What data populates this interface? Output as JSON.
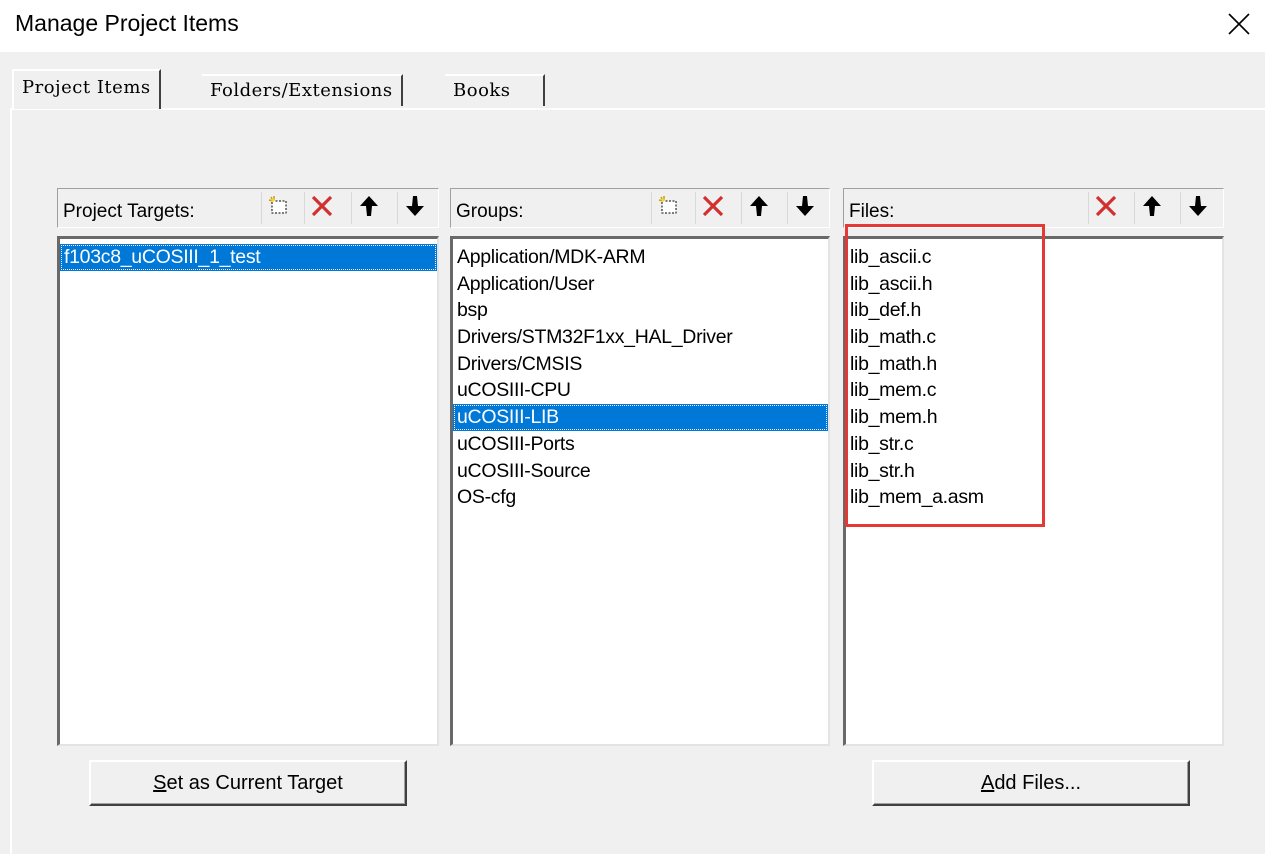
{
  "window": {
    "title": "Manage Project Items"
  },
  "tabs": [
    {
      "label": "Project Items",
      "active": true
    },
    {
      "label": "Folders/Extensions",
      "active": false
    },
    {
      "label": "Books",
      "active": false
    }
  ],
  "targets_panel": {
    "header": "Project Targets:",
    "items": [
      "f103c8_uCOSIII_1_test"
    ],
    "selected_index": 0
  },
  "groups_panel": {
    "header": "Groups:",
    "items": [
      "Application/MDK-ARM",
      "Application/User",
      "bsp",
      "Drivers/STM32F1xx_HAL_Driver",
      "Drivers/CMSIS",
      "uCOSIII-CPU",
      "uCOSIII-LIB",
      "uCOSIII-Ports",
      "uCOSIII-Source",
      "OS-cfg"
    ],
    "selected_index": 6
  },
  "files_panel": {
    "header": "Files:",
    "items": [
      "lib_ascii.c",
      "lib_ascii.h",
      "lib_def.h",
      "lib_math.c",
      "lib_math.h",
      "lib_mem.c",
      "lib_mem.h",
      "lib_str.c",
      "lib_str.h",
      "lib_mem_a.asm"
    ]
  },
  "buttons": {
    "set_current_target": "Set as Current Target",
    "add_files": "Add Files..."
  },
  "icons": {
    "new": "new-item-icon",
    "delete": "delete-x-icon",
    "up": "move-up-arrow-icon",
    "down": "move-down-arrow-icon",
    "close": "close-icon"
  },
  "colors": {
    "selection": "#0078d7",
    "delete_icon": "#d32f2f",
    "highlight_box": "#e53935",
    "dialog_bg": "#f0f0f0"
  }
}
